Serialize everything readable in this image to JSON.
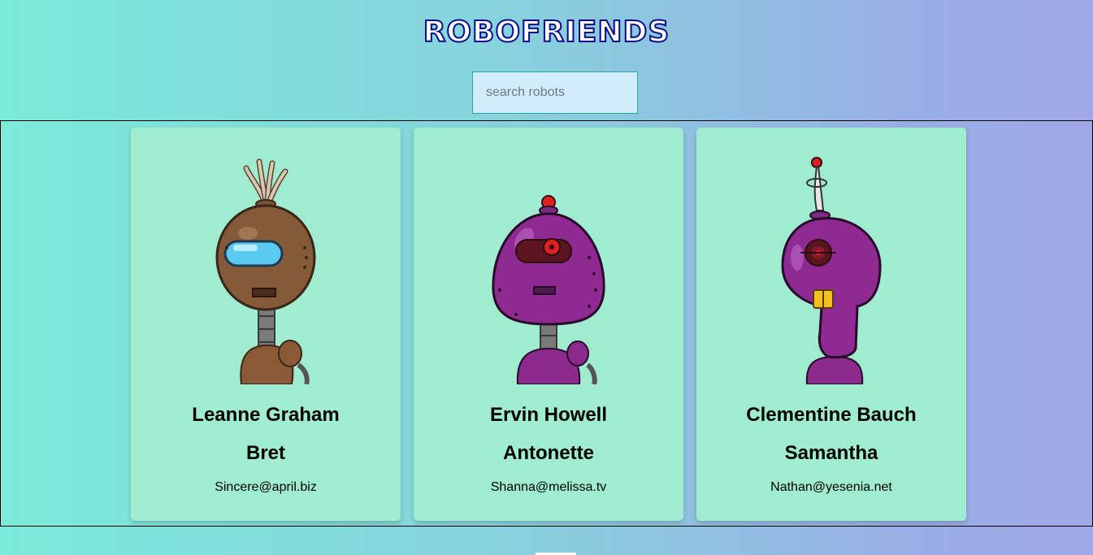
{
  "header": {
    "title": "ROBOFRIENDS"
  },
  "search": {
    "placeholder": "search robots",
    "value": ""
  },
  "robots": [
    {
      "name": "Leanne Graham",
      "username": "Bret",
      "email": "Sincere@april.biz",
      "image_icon": "robot-avatar-brown"
    },
    {
      "name": "Ervin Howell",
      "username": "Antonette",
      "email": "Shanna@melissa.tv",
      "image_icon": "robot-avatar-purple"
    },
    {
      "name": "Clementine Bauch",
      "username": "Samantha",
      "email": "Nathan@yesenia.net",
      "image_icon": "robot-avatar-magenta"
    }
  ],
  "colors": {
    "title": "#0a0a8c",
    "card": "#9fecd0",
    "search_bg": "#d1ecfb",
    "search_border": "#2aa89a"
  }
}
